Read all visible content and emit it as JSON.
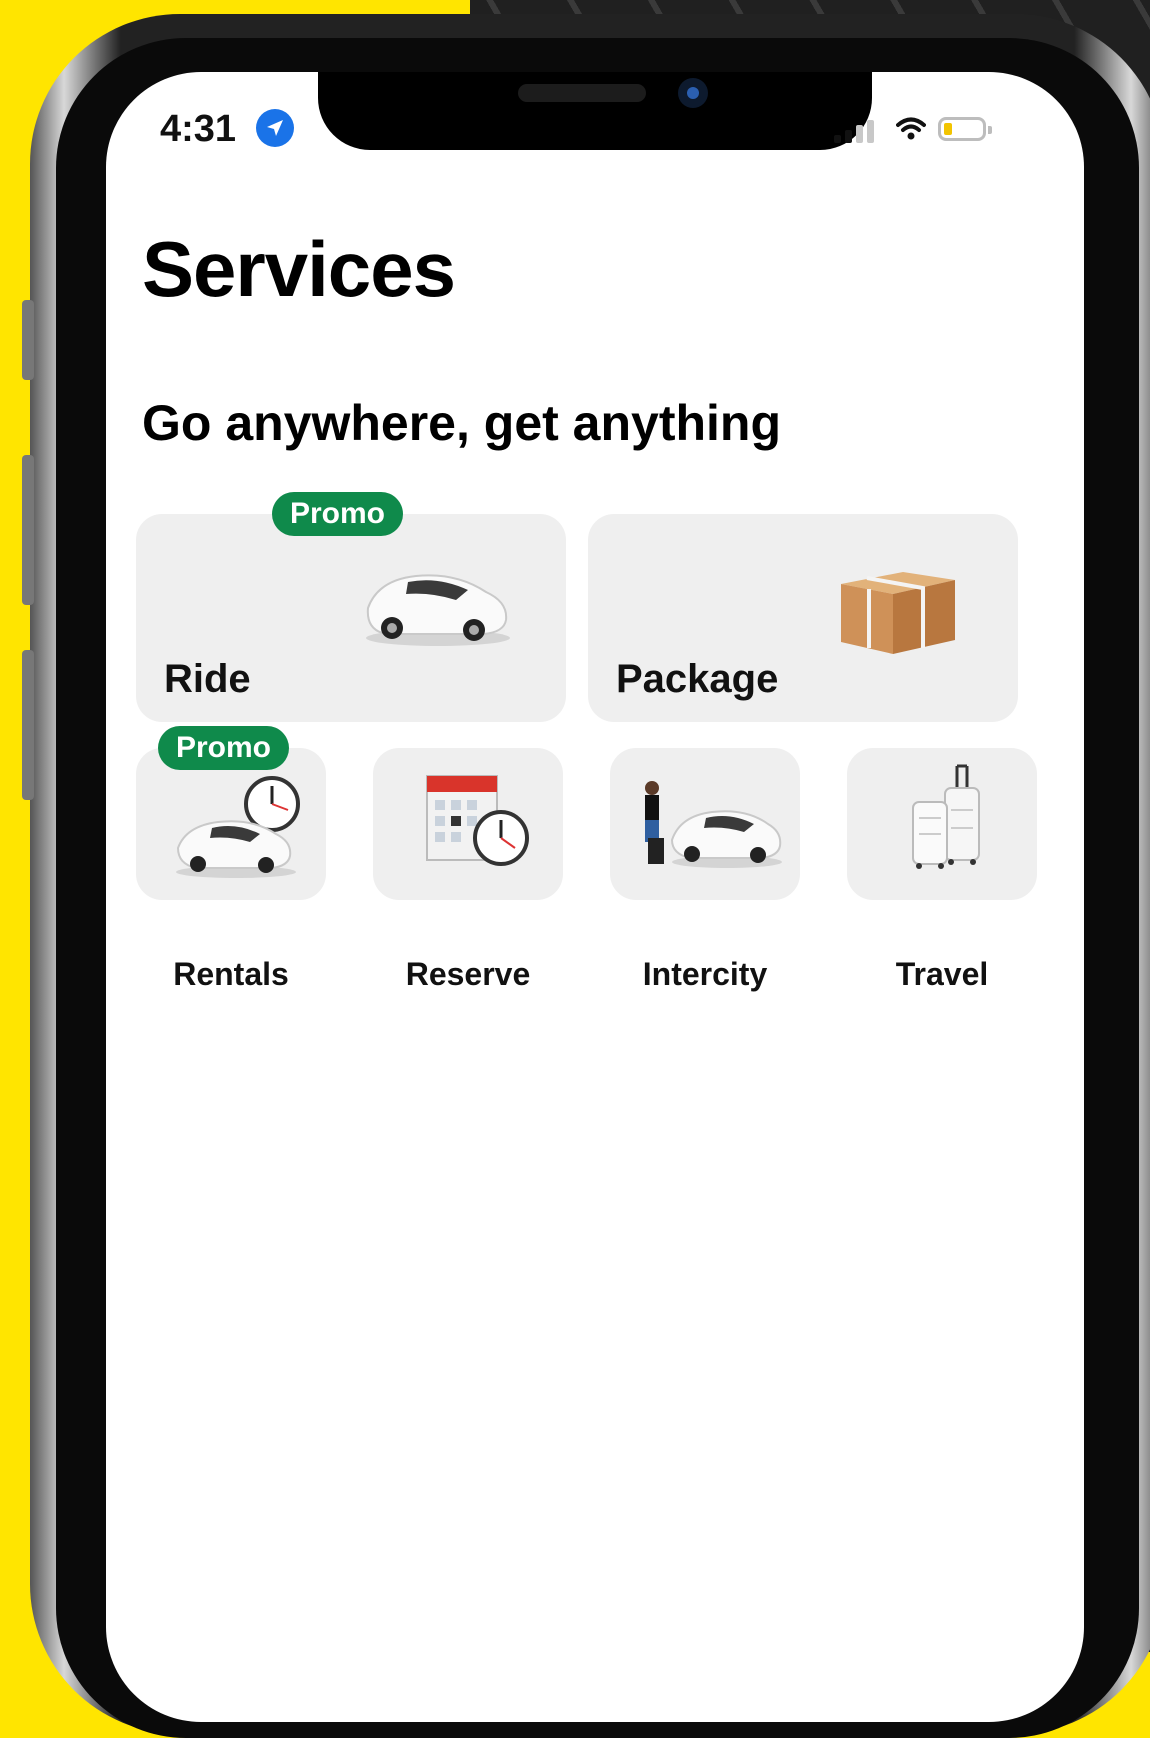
{
  "status_bar": {
    "time": "4:31"
  },
  "header": {
    "title": "Services"
  },
  "section": {
    "title": "Go anywhere, get anything"
  },
  "large_services": [
    {
      "label": "Ride",
      "promo": "Promo",
      "icon": "car-icon"
    },
    {
      "label": "Package",
      "icon": "package-icon"
    }
  ],
  "small_services": [
    {
      "label": "Rentals",
      "promo": "Promo",
      "icon": "car-clock-icon"
    },
    {
      "label": "Reserve",
      "icon": "calendar-clock-icon"
    },
    {
      "label": "Intercity",
      "icon": "traveler-car-icon"
    },
    {
      "label": "Travel",
      "icon": "luggage-icon"
    }
  ],
  "colors": {
    "promo": "#0f8a4b",
    "card": "#efefef",
    "background": "#ffe500",
    "location": "#1a73e8"
  }
}
